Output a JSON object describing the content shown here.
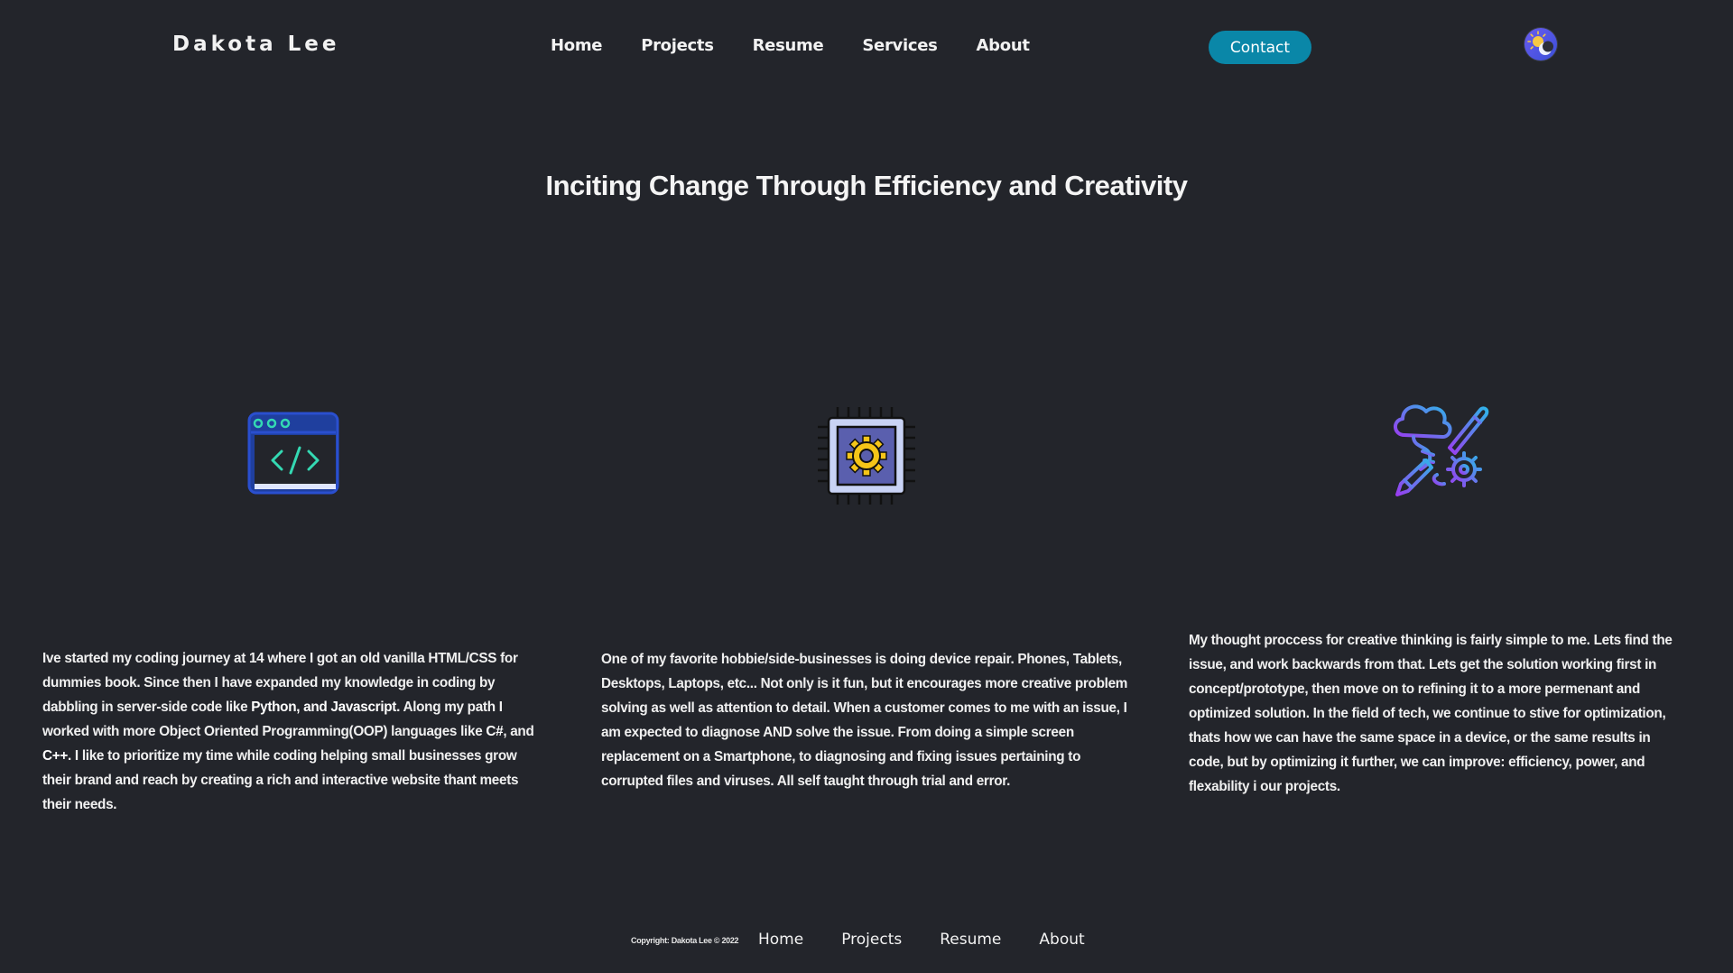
{
  "header": {
    "brand": "Dakota Lee",
    "nav": [
      "Home",
      "Projects",
      "Resume",
      "Services",
      "About"
    ],
    "contact_label": "Contact"
  },
  "hero": {
    "headline": "Inciting Change Through Efficiency and Creativity"
  },
  "columns": [
    {
      "icon": "code-window-icon",
      "parts": [
        "Ive started my coding journey at 14 where I got an old vanilla HTML/CSS for dummies book. Since then I have expanded my knowledge in coding by dabbling in server-side code like ",
        "Python, and Javascript",
        ". Along my path I worked with more Object Oriented Programming(OOP) languages like ",
        "C#",
        ", and ",
        "C++",
        ". I like to prioritize my time while coding helping small businesses grow their brand and reach by creating a rich and interactive website thant meets their needs."
      ]
    },
    {
      "icon": "cpu-chip-icon",
      "text": "One of my favorite hobbie/side-businesses is doing device repair. Phones, Tablets, Desktops, Laptops, etc... Not only is it fun, but it encourages more creative problem solving as well as attention to detail. When a customer comes to me with an issue, I am expected to diagnose AND solve the issue. From doing a simple screen replacement on a Smartphone, to diagnosing and fixing issues pertaining to corrupted files and viruses. All self taught through trial and error."
    },
    {
      "icon": "creative-thinking-icon",
      "text": "My thought proccess for creative thinking is fairly simple to me. Lets find the issue, and work backwards from that. Lets get the solution working first in concept/prototype, then move on to refining it to a more permenant and optimized solution. In the field of tech, we continue to stive for optimization, thats how we can have the same space in a device, or the same results in code, but by optimizing it further, we can improve: efficiency, power, and flexability i our projects."
    }
  ],
  "footer": {
    "copyright": "Copyright: Dakota Lee © 2022",
    "nav": [
      "Home",
      "Projects",
      "Resume",
      "About"
    ]
  },
  "colors": {
    "background": "#23252b",
    "accent": "#0a87a8",
    "text": "#f0f0f0"
  }
}
